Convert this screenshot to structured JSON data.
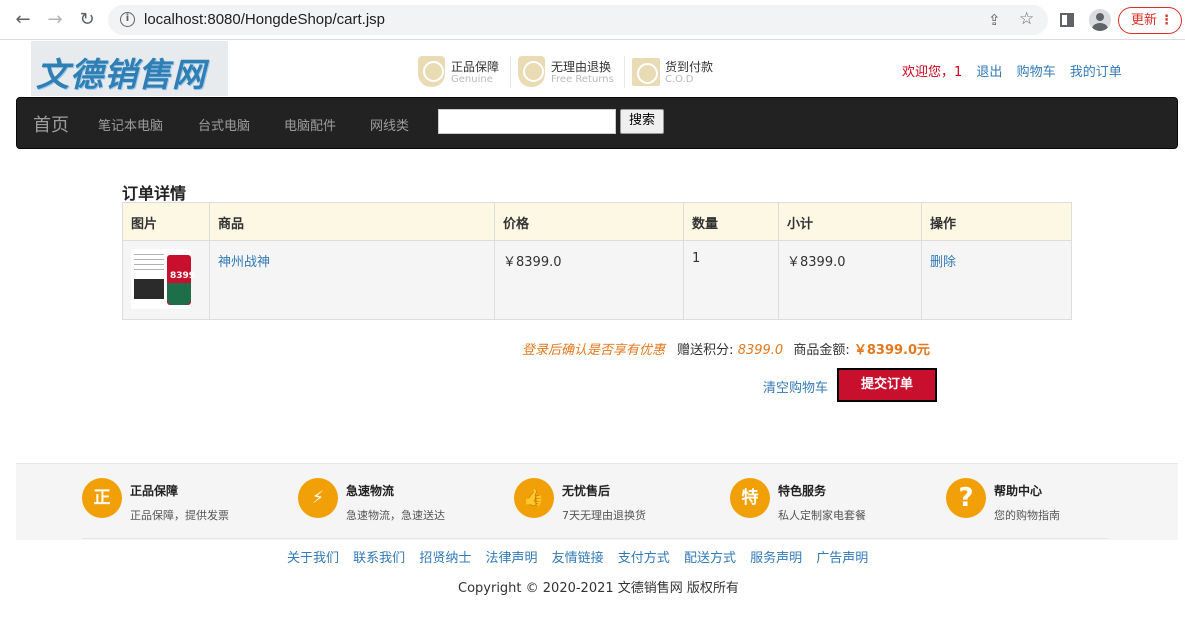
{
  "browser": {
    "url": "localhost:8080/HongdeShop/cart.jsp",
    "update_label": "更新"
  },
  "header": {
    "logo_text": "文德销售网",
    "promises": [
      {
        "title": "正品保障",
        "subtitle": "Genuine",
        "icon": "genuine-shield-icon"
      },
      {
        "title": "无理由退换",
        "subtitle": "Free Returns",
        "icon": "return-shield-icon"
      },
      {
        "title": "货到付款",
        "subtitle": "C.O.D",
        "icon": "cod-icon"
      }
    ],
    "welcome": "欢迎您，1",
    "logout": "退出",
    "cart": "购物车",
    "orders": "我的订单"
  },
  "navbar": {
    "brand": "首页",
    "items": [
      "笔记本电脑",
      "台式电脑",
      "电脑配件",
      "网线类"
    ],
    "search_value": "",
    "search_button": "搜索"
  },
  "cart": {
    "title": "订单详情",
    "columns": [
      "图片",
      "商品",
      "价格",
      "数量",
      "小计",
      "操作"
    ],
    "rows": [
      {
        "product": "神州战神",
        "price": "￥8399.0",
        "quantity": "1",
        "subtotal": "￥8399.0",
        "action": "删除",
        "thumb_price": "8399"
      }
    ],
    "login_note": "登录后确认是否享有优惠",
    "points_label": "赠送积分:",
    "points_value": "8399.0",
    "amount_label": "商品金额:",
    "amount_value": "￥8399.0元",
    "clear_cart": "清空购物车",
    "submit": "提交订单"
  },
  "footer": {
    "features": [
      {
        "title": "正品保障",
        "desc": "正品保障，提供发票",
        "icon": "genuine-icon"
      },
      {
        "title": "急速物流",
        "desc": "急速物流，急速送达",
        "icon": "logistics-icon"
      },
      {
        "title": "无忧售后",
        "desc": "7天无理由退换货",
        "icon": "thumbs-up-icon"
      },
      {
        "title": "特色服务",
        "desc": "私人定制家电套餐",
        "icon": "special-service-icon"
      },
      {
        "title": "帮助中心",
        "desc": "您的购物指南",
        "icon": "help-icon"
      }
    ],
    "links": [
      "关于我们",
      "联系我们",
      "招贤纳士",
      "法律声明",
      "友情链接",
      "支付方式",
      "配送方式",
      "服务声明",
      "广告声明"
    ],
    "copyright": "Copyright © 2020-2021 文德销售网 版权所有"
  }
}
